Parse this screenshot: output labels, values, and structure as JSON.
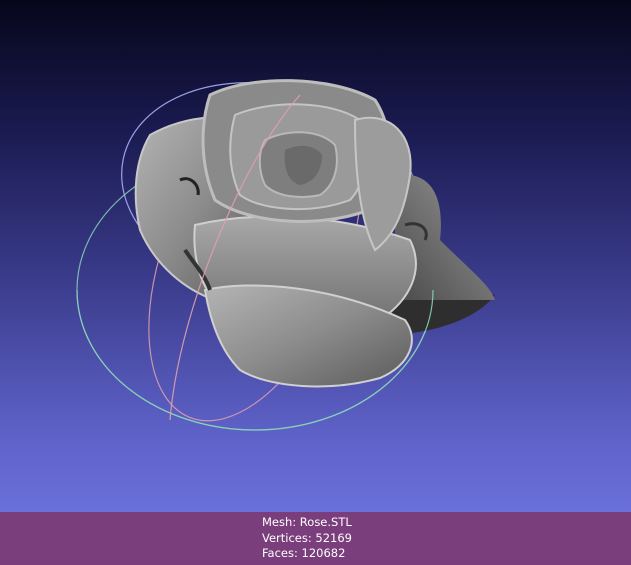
{
  "viewport": {
    "model_icon": "rose-mesh-icon",
    "trackball_icon": "trackball-gizmo-icon",
    "background_top_color": "#06061a",
    "background_bottom_color": "#6a70da",
    "mesh_color": "#8e8e8e"
  },
  "info": {
    "mesh_line": "Mesh: Rose.STL",
    "vertices_line": "Vertices: 52169",
    "faces_line": "Faces: 120682"
  },
  "colors": {
    "info_bar": "#7b3e7c",
    "trackball_red": "#e0a0b0",
    "trackball_green": "#8ad0b8",
    "trackball_blue": "#b0b8ff"
  }
}
